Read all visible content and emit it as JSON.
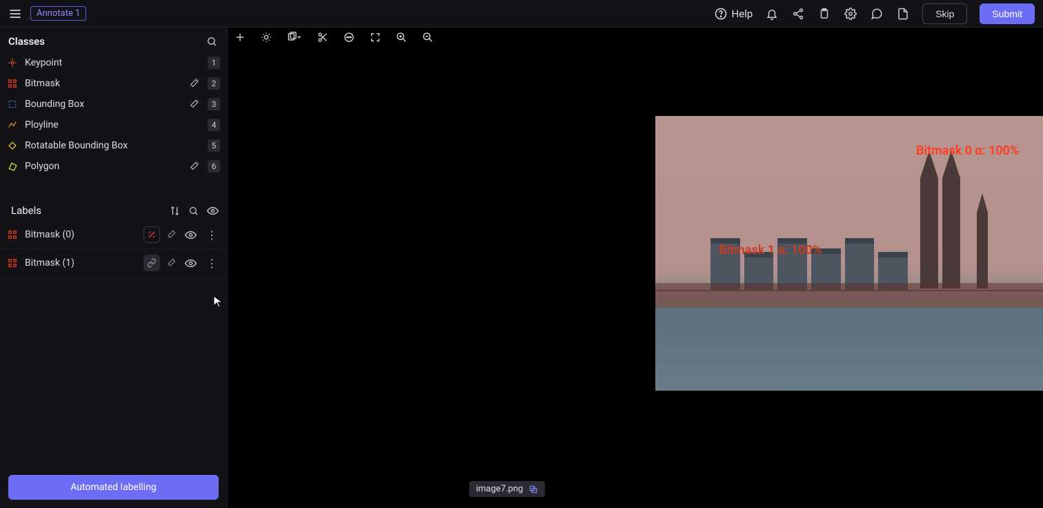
{
  "header": {
    "annotate_tag": "Annotate 1",
    "help": "Help",
    "skip": "Skip",
    "submit": "Submit"
  },
  "classes_panel": {
    "title": "Classes",
    "items": [
      {
        "name": "Keypoint",
        "key": "1",
        "color": "#ff5a2a",
        "wand": false
      },
      {
        "name": "Bitmask",
        "key": "2",
        "color": "#ff3b20",
        "wand": true
      },
      {
        "name": "Bounding Box",
        "key": "3",
        "color": "#4a7dff",
        "wand": true
      },
      {
        "name": "Ployline",
        "key": "4",
        "color": "#ff9a2a",
        "wand": false
      },
      {
        "name": "Rotatable Bounding Box",
        "key": "5",
        "color": "#ffd93b",
        "wand": false
      },
      {
        "name": "Polygon",
        "key": "6",
        "color": "#d8ff3b",
        "wand": true
      }
    ]
  },
  "labels_panel": {
    "title": "Labels",
    "items": [
      {
        "name": "Bitmask (0)",
        "color": "#ff3b20",
        "chip": "ai-off"
      },
      {
        "name": "Bitmask (1)",
        "color": "#ff3b20",
        "chip": "link"
      }
    ]
  },
  "automated_button": "Automated labelling",
  "filename": "image7.png",
  "annotations": [
    {
      "text": "Bitmask 0  α: 100%"
    },
    {
      "text": "Bitmask 1  α: 100%"
    }
  ]
}
